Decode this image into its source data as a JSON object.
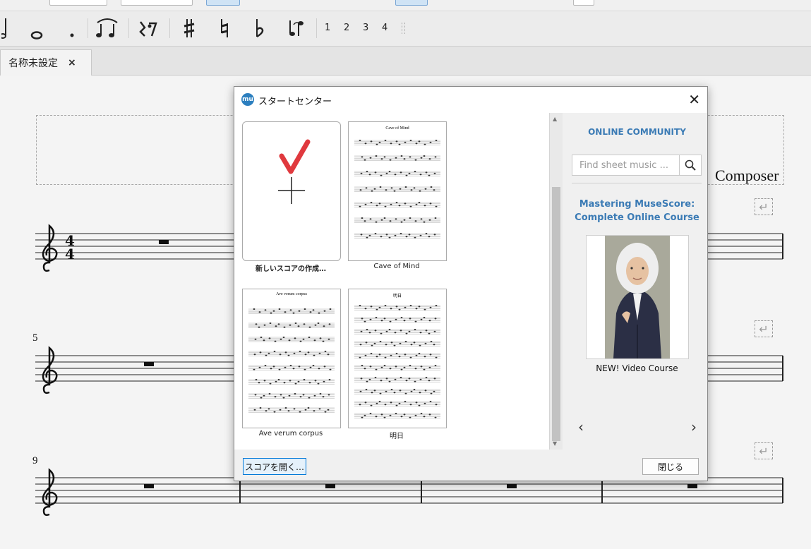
{
  "tab": {
    "title": "名称未設定",
    "close": "×"
  },
  "palette": {
    "voices": [
      "1",
      "2",
      "3",
      "4"
    ]
  },
  "score": {
    "composer": "Composer",
    "measure_numbers": [
      "5",
      "9"
    ],
    "time_signature": {
      "top": "4",
      "bottom": "4"
    },
    "linebreak_glyph": "↵"
  },
  "dialog": {
    "title": "スタートセンター",
    "logo": "mu",
    "close_glyph": "✕",
    "scores": [
      {
        "caption": "新しいスコアの作成…",
        "type": "new"
      },
      {
        "caption": "Cave of Mind",
        "type": "score",
        "header": "Cave of Mind"
      },
      {
        "caption": "Ave verum corpus",
        "type": "score",
        "header": "Ave verum corpus"
      },
      {
        "caption": "明日",
        "type": "score",
        "header": "明日"
      }
    ],
    "community": {
      "title": "ONLINE COMMUNITY",
      "search_placeholder": "Find sheet music ...",
      "course_title_1": "Mastering MuseScore:",
      "course_title_2": "Complete Online Course",
      "course_caption": "NEW! Video Course",
      "prev": "‹",
      "next": "›"
    },
    "open_button": "スコアを開く…",
    "close_button": "閉じる"
  },
  "colors": {
    "accent": "#3b7bb5",
    "checkmark": "#e0393e",
    "logo": "#2c7fbf"
  }
}
